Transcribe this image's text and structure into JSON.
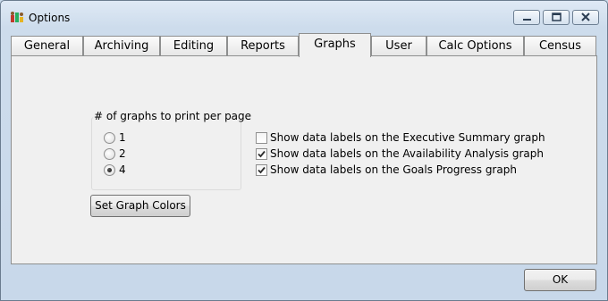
{
  "window": {
    "title": "Options",
    "controls": {
      "minimize": "minimize",
      "maximize": "maximize",
      "close": "close"
    }
  },
  "tabs": [
    {
      "label": "General",
      "active": false
    },
    {
      "label": "Archiving",
      "active": false
    },
    {
      "label": "Editing",
      "active": false
    },
    {
      "label": "Reports",
      "active": false
    },
    {
      "label": "Graphs",
      "active": true
    },
    {
      "label": "User",
      "active": false
    },
    {
      "label": "Calc Options",
      "active": false
    },
    {
      "label": "Census",
      "active": false
    }
  ],
  "graphs_per_page": {
    "label": "# of graphs to print per page",
    "options": [
      {
        "label": "1",
        "selected": false
      },
      {
        "label": "2",
        "selected": false
      },
      {
        "label": "4",
        "selected": true
      }
    ]
  },
  "data_labels": [
    {
      "label": "Show data labels on the Executive Summary graph",
      "checked": false
    },
    {
      "label": "Show data labels on the Availability Analysis graph",
      "checked": true
    },
    {
      "label": "Show data labels on the Goals Progress graph",
      "checked": true
    }
  ],
  "buttons": {
    "set_graph_colors": "Set Graph Colors",
    "ok": "OK"
  }
}
